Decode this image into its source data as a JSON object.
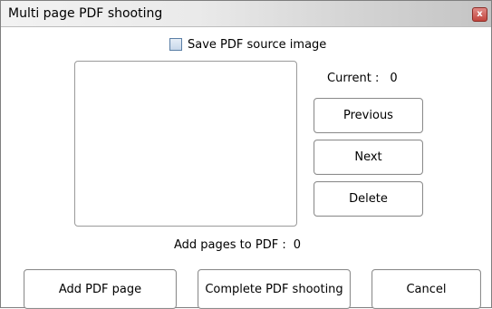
{
  "window": {
    "title": "Multi page PDF shooting",
    "close_glyph": "x"
  },
  "options": {
    "save_source_label": "Save PDF source image",
    "save_source_checked": false
  },
  "status": {
    "current_label": "Current :",
    "current_value": "0",
    "add_pages_label": "Add pages to PDF :",
    "add_pages_value": "0"
  },
  "side_buttons": {
    "previous": "Previous",
    "next": "Next",
    "delete": "Delete"
  },
  "bottom_buttons": {
    "add_page": "Add PDF page",
    "complete": "Complete PDF shooting",
    "cancel": "Cancel"
  }
}
